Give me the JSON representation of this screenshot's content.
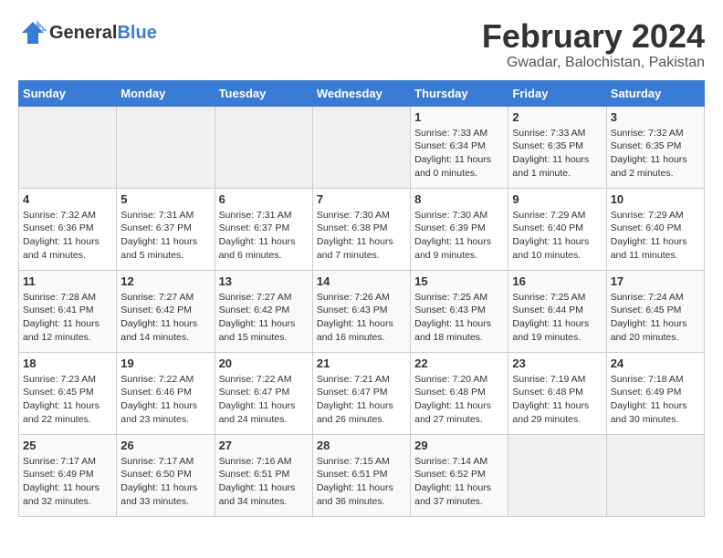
{
  "header": {
    "logo_general": "General",
    "logo_blue": "Blue",
    "title": "February 2024",
    "subtitle": "Gwadar, Balochistan, Pakistan"
  },
  "days_of_week": [
    "Sunday",
    "Monday",
    "Tuesday",
    "Wednesday",
    "Thursday",
    "Friday",
    "Saturday"
  ],
  "weeks": [
    [
      {
        "day": "",
        "sunrise": "",
        "sunset": "",
        "daylight": ""
      },
      {
        "day": "",
        "sunrise": "",
        "sunset": "",
        "daylight": ""
      },
      {
        "day": "",
        "sunrise": "",
        "sunset": "",
        "daylight": ""
      },
      {
        "day": "",
        "sunrise": "",
        "sunset": "",
        "daylight": ""
      },
      {
        "day": "1",
        "sunrise": "Sunrise: 7:33 AM",
        "sunset": "Sunset: 6:34 PM",
        "daylight": "Daylight: 11 hours and 0 minutes."
      },
      {
        "day": "2",
        "sunrise": "Sunrise: 7:33 AM",
        "sunset": "Sunset: 6:35 PM",
        "daylight": "Daylight: 11 hours and 1 minute."
      },
      {
        "day": "3",
        "sunrise": "Sunrise: 7:32 AM",
        "sunset": "Sunset: 6:35 PM",
        "daylight": "Daylight: 11 hours and 2 minutes."
      }
    ],
    [
      {
        "day": "4",
        "sunrise": "Sunrise: 7:32 AM",
        "sunset": "Sunset: 6:36 PM",
        "daylight": "Daylight: 11 hours and 4 minutes."
      },
      {
        "day": "5",
        "sunrise": "Sunrise: 7:31 AM",
        "sunset": "Sunset: 6:37 PM",
        "daylight": "Daylight: 11 hours and 5 minutes."
      },
      {
        "day": "6",
        "sunrise": "Sunrise: 7:31 AM",
        "sunset": "Sunset: 6:37 PM",
        "daylight": "Daylight: 11 hours and 6 minutes."
      },
      {
        "day": "7",
        "sunrise": "Sunrise: 7:30 AM",
        "sunset": "Sunset: 6:38 PM",
        "daylight": "Daylight: 11 hours and 7 minutes."
      },
      {
        "day": "8",
        "sunrise": "Sunrise: 7:30 AM",
        "sunset": "Sunset: 6:39 PM",
        "daylight": "Daylight: 11 hours and 9 minutes."
      },
      {
        "day": "9",
        "sunrise": "Sunrise: 7:29 AM",
        "sunset": "Sunset: 6:40 PM",
        "daylight": "Daylight: 11 hours and 10 minutes."
      },
      {
        "day": "10",
        "sunrise": "Sunrise: 7:29 AM",
        "sunset": "Sunset: 6:40 PM",
        "daylight": "Daylight: 11 hours and 11 minutes."
      }
    ],
    [
      {
        "day": "11",
        "sunrise": "Sunrise: 7:28 AM",
        "sunset": "Sunset: 6:41 PM",
        "daylight": "Daylight: 11 hours and 12 minutes."
      },
      {
        "day": "12",
        "sunrise": "Sunrise: 7:27 AM",
        "sunset": "Sunset: 6:42 PM",
        "daylight": "Daylight: 11 hours and 14 minutes."
      },
      {
        "day": "13",
        "sunrise": "Sunrise: 7:27 AM",
        "sunset": "Sunset: 6:42 PM",
        "daylight": "Daylight: 11 hours and 15 minutes."
      },
      {
        "day": "14",
        "sunrise": "Sunrise: 7:26 AM",
        "sunset": "Sunset: 6:43 PM",
        "daylight": "Daylight: 11 hours and 16 minutes."
      },
      {
        "day": "15",
        "sunrise": "Sunrise: 7:25 AM",
        "sunset": "Sunset: 6:43 PM",
        "daylight": "Daylight: 11 hours and 18 minutes."
      },
      {
        "day": "16",
        "sunrise": "Sunrise: 7:25 AM",
        "sunset": "Sunset: 6:44 PM",
        "daylight": "Daylight: 11 hours and 19 minutes."
      },
      {
        "day": "17",
        "sunrise": "Sunrise: 7:24 AM",
        "sunset": "Sunset: 6:45 PM",
        "daylight": "Daylight: 11 hours and 20 minutes."
      }
    ],
    [
      {
        "day": "18",
        "sunrise": "Sunrise: 7:23 AM",
        "sunset": "Sunset: 6:45 PM",
        "daylight": "Daylight: 11 hours and 22 minutes."
      },
      {
        "day": "19",
        "sunrise": "Sunrise: 7:22 AM",
        "sunset": "Sunset: 6:46 PM",
        "daylight": "Daylight: 11 hours and 23 minutes."
      },
      {
        "day": "20",
        "sunrise": "Sunrise: 7:22 AM",
        "sunset": "Sunset: 6:47 PM",
        "daylight": "Daylight: 11 hours and 24 minutes."
      },
      {
        "day": "21",
        "sunrise": "Sunrise: 7:21 AM",
        "sunset": "Sunset: 6:47 PM",
        "daylight": "Daylight: 11 hours and 26 minutes."
      },
      {
        "day": "22",
        "sunrise": "Sunrise: 7:20 AM",
        "sunset": "Sunset: 6:48 PM",
        "daylight": "Daylight: 11 hours and 27 minutes."
      },
      {
        "day": "23",
        "sunrise": "Sunrise: 7:19 AM",
        "sunset": "Sunset: 6:48 PM",
        "daylight": "Daylight: 11 hours and 29 minutes."
      },
      {
        "day": "24",
        "sunrise": "Sunrise: 7:18 AM",
        "sunset": "Sunset: 6:49 PM",
        "daylight": "Daylight: 11 hours and 30 minutes."
      }
    ],
    [
      {
        "day": "25",
        "sunrise": "Sunrise: 7:17 AM",
        "sunset": "Sunset: 6:49 PM",
        "daylight": "Daylight: 11 hours and 32 minutes."
      },
      {
        "day": "26",
        "sunrise": "Sunrise: 7:17 AM",
        "sunset": "Sunset: 6:50 PM",
        "daylight": "Daylight: 11 hours and 33 minutes."
      },
      {
        "day": "27",
        "sunrise": "Sunrise: 7:16 AM",
        "sunset": "Sunset: 6:51 PM",
        "daylight": "Daylight: 11 hours and 34 minutes."
      },
      {
        "day": "28",
        "sunrise": "Sunrise: 7:15 AM",
        "sunset": "Sunset: 6:51 PM",
        "daylight": "Daylight: 11 hours and 36 minutes."
      },
      {
        "day": "29",
        "sunrise": "Sunrise: 7:14 AM",
        "sunset": "Sunset: 6:52 PM",
        "daylight": "Daylight: 11 hours and 37 minutes."
      },
      {
        "day": "",
        "sunrise": "",
        "sunset": "",
        "daylight": ""
      },
      {
        "day": "",
        "sunrise": "",
        "sunset": "",
        "daylight": ""
      }
    ]
  ]
}
